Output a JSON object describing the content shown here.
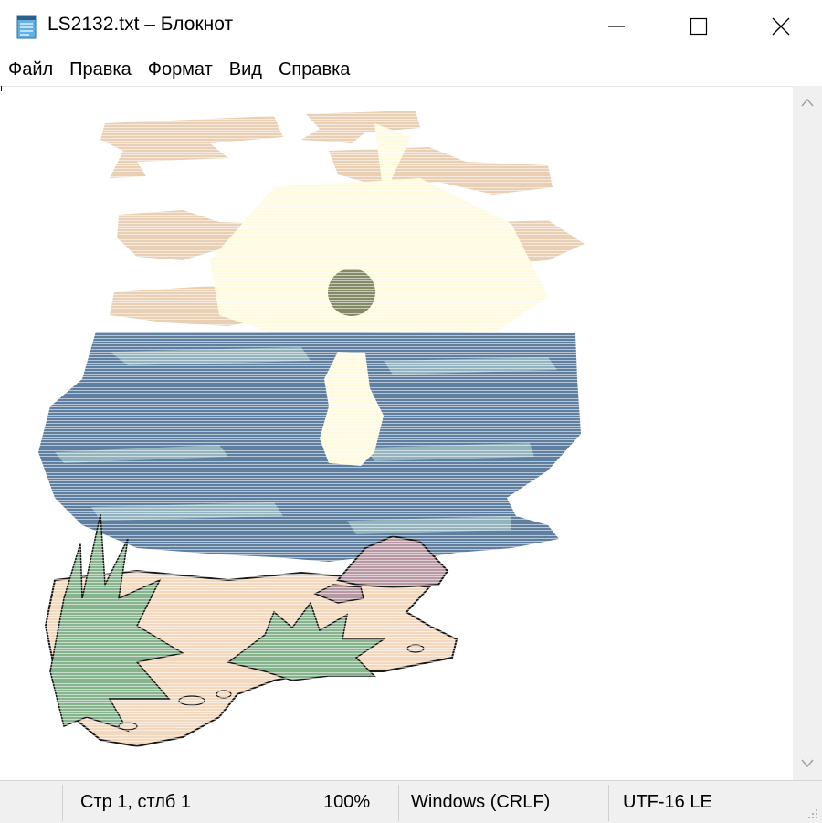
{
  "window": {
    "title": "LS2132.txt – Блокнот",
    "icon": "notepad-icon"
  },
  "menu": {
    "items": [
      "Файл",
      "Правка",
      "Формат",
      "Вид",
      "Справка"
    ]
  },
  "editor": {
    "content_description_icon": "ascii-art-seascape"
  },
  "status": {
    "position": "Стр 1, стлб 1",
    "zoom": "100%",
    "line_endings": "Windows (CRLF)",
    "encoding": "UTF-16 LE"
  },
  "colors": {
    "sand": "#f3d8bd",
    "water": "#5f7fa0",
    "water_light": "#93b4bf",
    "sun": "#858a66",
    "glow": "#fffbe0",
    "cloud": "#e9cfb3",
    "plant": "#86b48c",
    "rock": "#b898a2"
  }
}
